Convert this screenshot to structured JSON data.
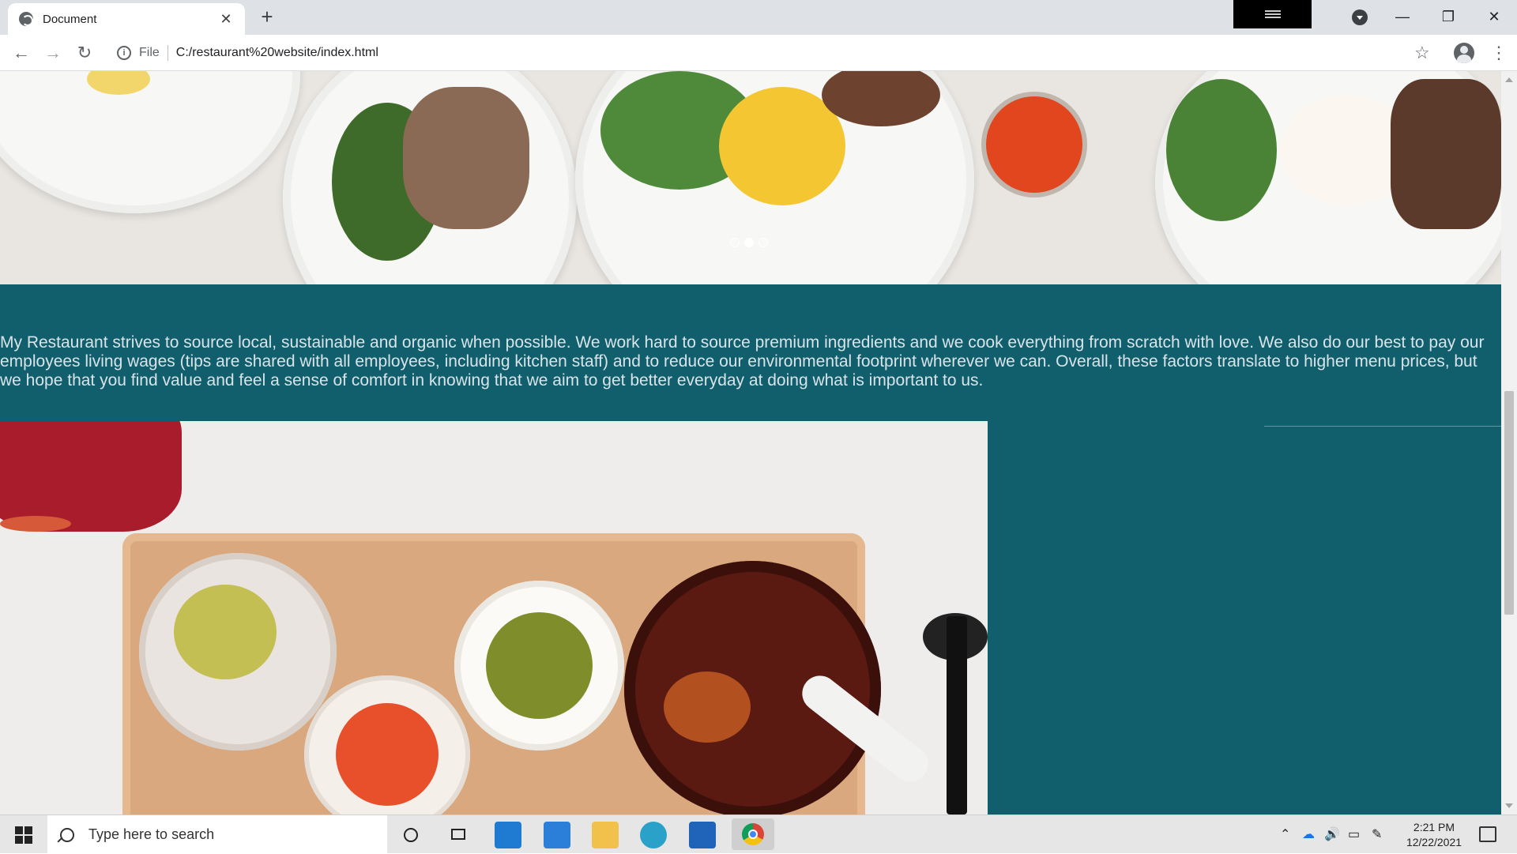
{
  "browser": {
    "tab_title": "Document",
    "tab_close": "✕",
    "new_tab": "+",
    "scheme_label": "File",
    "url": "C:/restaurant%20website/index.html",
    "back": "←",
    "forward": "→",
    "reload": "↻",
    "bookmark": "☆",
    "menu": "⋮",
    "minimize": "—",
    "restore": "❐",
    "close": "✕"
  },
  "page": {
    "carousel": {
      "slides": 3,
      "active_slide": 2
    },
    "about_text": "My Restaurant strives to source local, sustainable and organic when possible. We work hard to source premium ingredients and we cook everything from scratch with love. We also do our best to pay our employees living wages (tips are shared with all employees, including kitchen staff) and to reduce our environmental footprint wherever we can. Overall, these factors translate to higher menu prices, but we hope that you find value and feel a sense of comfort in knowing that we aim to get better everyday at doing what is important to us.",
    "colors": {
      "band": "#115e6d",
      "text": "#d9e4e8"
    }
  },
  "taskbar": {
    "search_placeholder": "Type here to search",
    "time": "2:21 PM",
    "date": "12/22/2021",
    "icons": [
      "start-icon",
      "cortana-icon",
      "task-view-icon",
      "vscode-icon",
      "mail-icon",
      "file-explorer-icon",
      "edge-icon",
      "store-icon",
      "chrome-icon"
    ]
  }
}
